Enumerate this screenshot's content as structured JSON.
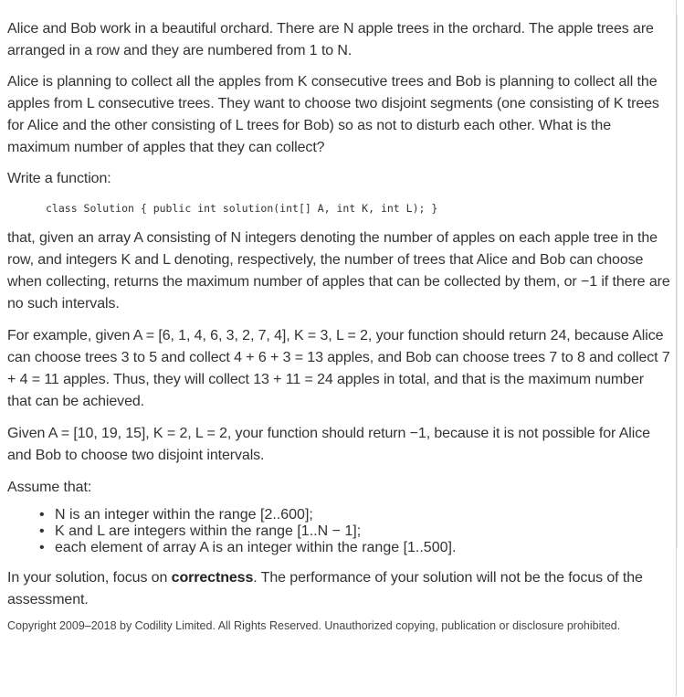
{
  "task": {
    "intro": "Alice and Bob work in a beautiful orchard. There are N apple trees in the orchard. The apple trees are arranged in a row and they are numbered from 1 to N.",
    "plan": "Alice is planning to collect all the apples from K consecutive trees and Bob is planning to collect all the apples from L consecutive trees. They want to choose two disjoint segments (one consisting of K trees for Alice and the other consisting of L trees for Bob) so as not to disturb each other. What is the maximum number of apples that they can collect?",
    "write_function": "Write a function:",
    "code": "class Solution { public int solution(int[] A, int K, int L); }",
    "description": "that, given an array A consisting of N integers denoting the number of apples on each apple tree in the row, and integers K and L denoting, respectively, the number of trees that Alice and Bob can choose when collecting, returns the maximum number of apples that can be collected by them, or −1 if there are no such intervals.",
    "example1": "For example, given A = [6, 1, 4, 6, 3, 2, 7, 4], K = 3, L = 2, your function should return 24, because Alice can choose trees 3 to 5 and collect 4 + 6 + 3 = 13 apples, and Bob can choose trees 7 to 8 and collect 7 + 4 = 11 apples. Thus, they will collect 13 + 11 = 24 apples in total, and that is the maximum number that can be achieved.",
    "example2": "Given A = [10, 19, 15], K = 2, L = 2, your function should return −1, because it is not possible for Alice and Bob to choose two disjoint intervals.",
    "assume": "Assume that:",
    "constraints": [
      "N is an integer within the range [2..600];",
      "K and L are integers within the range [1..N − 1];",
      "each element of array A is an integer within the range [1..500]."
    ],
    "focus_prefix": "In your solution, focus on ",
    "focus_bold": "correctness",
    "focus_suffix": ". The performance of your solution will not be the focus of the assessment.",
    "copyright": "Copyright 2009–2018 by Codility Limited. All Rights Reserved. Unauthorized copying, publication or disclosure prohibited."
  }
}
